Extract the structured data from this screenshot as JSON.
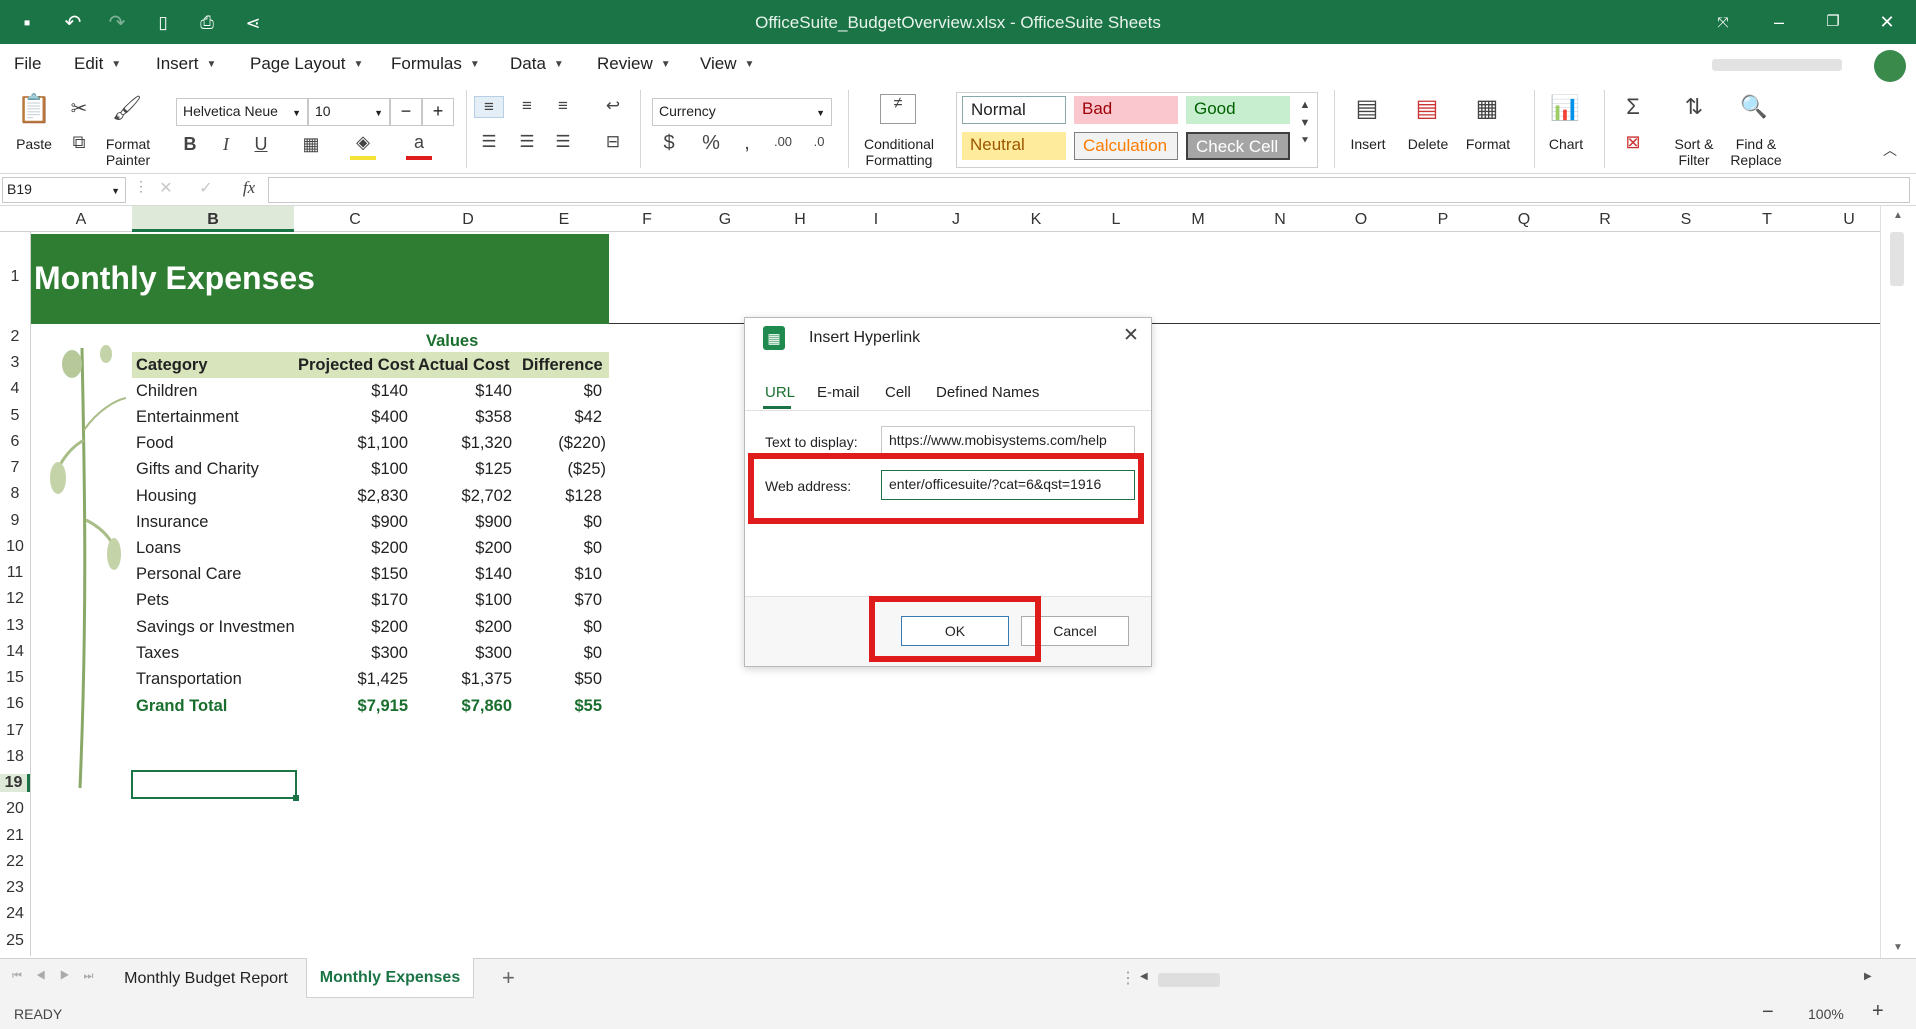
{
  "window": {
    "title": "OfficeSuite_BudgetOverview.xlsx - OfficeSuite Sheets"
  },
  "menu": {
    "file": "File",
    "edit": "Edit",
    "insert": "Insert",
    "page_layout": "Page Layout",
    "formulas": "Formulas",
    "data": "Data",
    "review": "Review",
    "view": "View"
  },
  "ribbon": {
    "paste": "Paste",
    "format_painter_1": "Format",
    "format_painter_2": "Painter",
    "font_name": "Helvetica Neue",
    "font_size": "10",
    "number_format": "Currency",
    "cond_fmt_1": "Conditional",
    "cond_fmt_2": "Formatting",
    "styles": {
      "normal": "Normal",
      "bad": "Bad",
      "good": "Good",
      "neutral": "Neutral",
      "calculation": "Calculation",
      "check_cell": "Check Cell"
    },
    "insert": "Insert",
    "delete": "Delete",
    "format": "Format",
    "chart": "Chart",
    "sort_1": "Sort &",
    "sort_2": "Filter",
    "find_1": "Find &",
    "find_2": "Replace"
  },
  "formula_bar": {
    "name_box": "B19",
    "fx": "fx",
    "formula": ""
  },
  "columns": [
    "A",
    "B",
    "C",
    "D",
    "E",
    "F",
    "G",
    "H",
    "I",
    "J",
    "K",
    "L",
    "M",
    "N",
    "O",
    "P",
    "Q",
    "R",
    "S",
    "T",
    "U"
  ],
  "rows": [
    "1",
    "2",
    "3",
    "4",
    "5",
    "6",
    "7",
    "8",
    "9",
    "10",
    "11",
    "12",
    "13",
    "14",
    "15",
    "16",
    "17",
    "18",
    "19",
    "20",
    "21",
    "22",
    "23",
    "24",
    "25"
  ],
  "sheet": {
    "title": "Monthly Expenses",
    "values_header": "Values",
    "headers": [
      "Category",
      "Projected Cost",
      "Actual Cost",
      "Difference"
    ],
    "data": [
      [
        "Children",
        "$140",
        "$140",
        "$0"
      ],
      [
        "Entertainment",
        "$400",
        "$358",
        "$42"
      ],
      [
        "Food",
        "$1,100",
        "$1,320",
        "($220)"
      ],
      [
        "Gifts and Charity",
        "$100",
        "$125",
        "($25)"
      ],
      [
        "Housing",
        "$2,830",
        "$2,702",
        "$128"
      ],
      [
        "Insurance",
        "$900",
        "$900",
        "$0"
      ],
      [
        "Loans",
        "$200",
        "$200",
        "$0"
      ],
      [
        "Personal Care",
        "$150",
        "$140",
        "$10"
      ],
      [
        "Pets",
        "$170",
        "$100",
        "$70"
      ],
      [
        "Savings or Investmen",
        "$200",
        "$200",
        "$0"
      ],
      [
        "Taxes",
        "$300",
        "$300",
        "$0"
      ],
      [
        "Transportation",
        "$1,425",
        "$1,375",
        "$50"
      ]
    ],
    "total": [
      "Grand Total",
      "$7,915",
      "$7,860",
      "$55"
    ]
  },
  "dialog": {
    "title": "Insert Hyperlink",
    "tabs": [
      "URL",
      "E-mail",
      "Cell",
      "Defined Names"
    ],
    "text_label": "Text to display:",
    "text_value": "https://www.mobisystems.com/help",
    "web_label": "Web address:",
    "web_value": "enter/officesuite/?cat=6&qst=1916",
    "ok": "OK",
    "cancel": "Cancel"
  },
  "sheet_tabs": [
    "Monthly Budget Report",
    "Monthly Expenses"
  ],
  "status": {
    "ready": "READY",
    "zoom": "100%"
  },
  "colors": {
    "brand": "#1a7445",
    "title_fill": "#2f7d32",
    "header_fill": "#d8e4bc",
    "highlight": "#e01b1b"
  }
}
